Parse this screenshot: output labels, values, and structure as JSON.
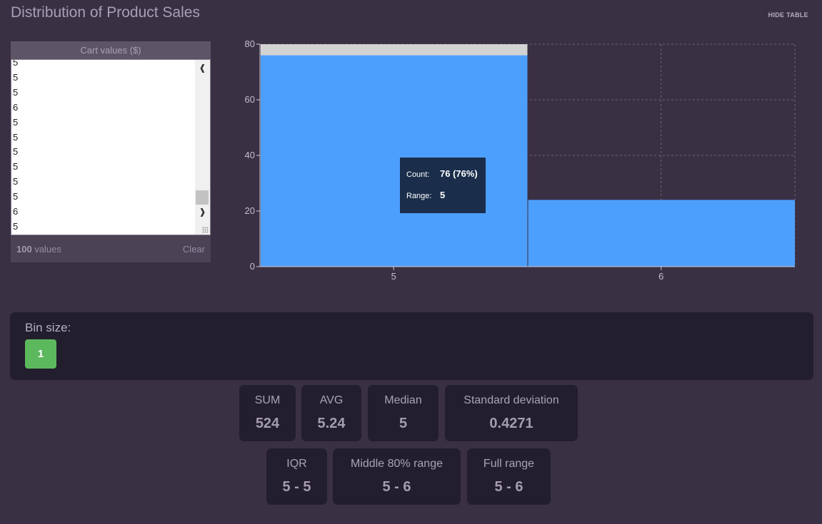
{
  "title": "Distribution of Product Sales",
  "hide_table_label": "HIDE TABLE",
  "values_panel": {
    "header": "Cart values ($)",
    "visible_values": [
      "5",
      "5",
      "5",
      "6",
      "5",
      "5",
      "5",
      "5",
      "5",
      "5",
      "6",
      "5"
    ],
    "count": "100",
    "count_suffix": " values",
    "clear_label": "Clear"
  },
  "chart_data": {
    "type": "bar",
    "categories": [
      "5",
      "6"
    ],
    "values": [
      76,
      24
    ],
    "ylim": [
      0,
      80
    ],
    "yticks": [
      "0",
      "20",
      "40",
      "60",
      "80"
    ],
    "grid": true,
    "highlighted_bar_index": 0,
    "bar_color": "#4d9ffe",
    "highlight_color": "#d3d3d3"
  },
  "tooltip": {
    "count_label": "Count:",
    "count_value": "76 (76%)",
    "range_label": "Range:",
    "range_value": "5"
  },
  "bin": {
    "label": "Bin size:",
    "value": "1",
    "color": "#5cb85c"
  },
  "stats": {
    "sum": {
      "label": "SUM",
      "value": "524"
    },
    "avg": {
      "label": "AVG",
      "value": "5.24"
    },
    "median": {
      "label": "Median",
      "value": "5"
    },
    "std": {
      "label": "Standard deviation",
      "value": "0.4271"
    },
    "iqr": {
      "label": "IQR",
      "value": "5 - 5"
    },
    "middle80": {
      "label": "Middle 80% range",
      "value": "5 - 6"
    },
    "full": {
      "label": "Full range",
      "value": "5 - 6"
    }
  }
}
